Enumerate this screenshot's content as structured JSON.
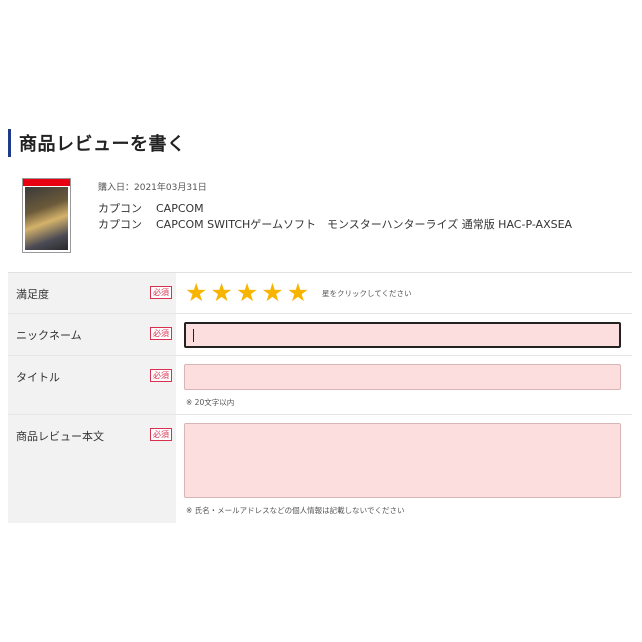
{
  "page": {
    "title": "商品レビューを書く"
  },
  "product": {
    "purchase_date": "購入日：2021年03月31日",
    "maker_kana": "カプコン",
    "maker": "CAPCOM",
    "maker_kana2": "カプコン",
    "product_name": "CAPCOM SWITCHゲームソフト　モンスターハンターライズ 通常版 HAC-P-AXSEA"
  },
  "form": {
    "required_label": "必須",
    "rating": {
      "label": "満足度",
      "value": 5,
      "max": 5,
      "star_color": "#f7b500",
      "hint": "星をクリックしてください"
    },
    "nickname": {
      "label": "ニックネーム",
      "value": ""
    },
    "title": {
      "label": "タイトル",
      "value": "",
      "note": "※ 20文字以内"
    },
    "body": {
      "label": "商品レビュー本文",
      "value": "",
      "note": "※ 氏名・メールアドレスなどの個人情報は記載しないでください"
    }
  },
  "colors": {
    "accent_bar": "#1e3a8a",
    "required": "#d9304f",
    "input_bg": "#fddede"
  }
}
